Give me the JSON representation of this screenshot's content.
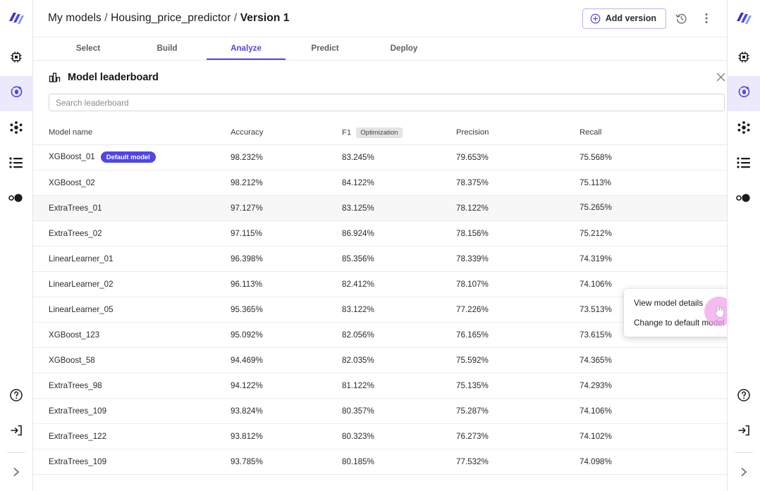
{
  "theme": {
    "accent": "#5046e5",
    "accent_soft": "#ebe9fb",
    "badge": "#5046e5",
    "cursor_halo": "#f3a0ef",
    "row_hover": "#f7f7f8",
    "page_bg": "#f4f4f4"
  },
  "breadcrumb": {
    "root": "My models",
    "project": "Housing_price_predictor",
    "current": "Version 1",
    "separator": "/"
  },
  "topbar": {
    "add_version_label": "Add version",
    "add_version_icon": "plus-circle-icon",
    "history_icon": "history-clock-icon",
    "more_icon": "kebab-vertical-icon"
  },
  "tabs": [
    {
      "label": "Select",
      "active": false
    },
    {
      "label": "Build",
      "active": false
    },
    {
      "label": "Analyze",
      "active": true
    },
    {
      "label": "Predict",
      "active": false
    },
    {
      "label": "Deploy",
      "active": false
    }
  ],
  "panel": {
    "title": "Model leaderboard",
    "title_icon": "bar-chart-icon",
    "close_icon": "close-icon"
  },
  "search": {
    "placeholder": "Search leaderboard",
    "value": ""
  },
  "table": {
    "columns": [
      {
        "key": "name",
        "label": "Model name"
      },
      {
        "key": "accuracy",
        "label": "Accuracy"
      },
      {
        "key": "f1",
        "label": "F1",
        "chip": "Optimization"
      },
      {
        "key": "precision",
        "label": "Precision"
      },
      {
        "key": "recall",
        "label": "Recall"
      }
    ],
    "default_badge": "Default model",
    "rows": [
      {
        "name": "XGBoost_01",
        "badge": "Default model",
        "accuracy": "98.232%",
        "f1": "83.245%",
        "precision": "79.653%",
        "recall": "75.568%",
        "hover": false
      },
      {
        "name": "XGBoost_02",
        "badge": "",
        "accuracy": "98.212%",
        "f1": "84.122%",
        "precision": "78.375%",
        "recall": "75.113%",
        "hover": false
      },
      {
        "name": "ExtraTrees_01",
        "badge": "",
        "accuracy": "97.127%",
        "f1": "83.125%",
        "precision": "78.122%",
        "recall": "75.265%",
        "hover": true
      },
      {
        "name": "ExtraTrees_02",
        "badge": "",
        "accuracy": "97.115%",
        "f1": "86.924%",
        "precision": "78.156%",
        "recall": "75.212%",
        "hover": false
      },
      {
        "name": "LinearLearner_01",
        "badge": "",
        "accuracy": "96.398%",
        "f1": "85.356%",
        "precision": "78.339%",
        "recall": "74.319%",
        "hover": false
      },
      {
        "name": "LinearLearner_02",
        "badge": "",
        "accuracy": "96.113%",
        "f1": "82.412%",
        "precision": "78.107%",
        "recall": "74.106%",
        "hover": false
      },
      {
        "name": "LinearLearner_05",
        "badge": "",
        "accuracy": "95.365%",
        "f1": "83.122%",
        "precision": "77.226%",
        "recall": "73.513%",
        "hover": false
      },
      {
        "name": "XGBoost_123",
        "badge": "",
        "accuracy": "95.092%",
        "f1": "82.056%",
        "precision": "76.165%",
        "recall": "73.615%",
        "hover": false
      },
      {
        "name": "XGBoost_58",
        "badge": "",
        "accuracy": "94.469%",
        "f1": "82.035%",
        "precision": "75.592%",
        "recall": "74.365%",
        "hover": false
      },
      {
        "name": "ExtraTrees_98",
        "badge": "",
        "accuracy": "94.122%",
        "f1": "81.122%",
        "precision": "75.135%",
        "recall": "74.293%",
        "hover": false
      },
      {
        "name": "ExtraTrees_109",
        "badge": "",
        "accuracy": "93.824%",
        "f1": "80.357%",
        "precision": "75.287%",
        "recall": "74.106%",
        "hover": false
      },
      {
        "name": "ExtraTrees_122",
        "badge": "",
        "accuracy": "93.812%",
        "f1": "80.323%",
        "precision": "76.273%",
        "recall": "74.102%",
        "hover": false
      },
      {
        "name": "ExtraTrees_109",
        "badge": "",
        "accuracy": "93.785%",
        "f1": "80.185%",
        "precision": "77.532%",
        "recall": "74.098%",
        "hover": false
      }
    ]
  },
  "row_menu": {
    "items": [
      {
        "label": "View model details"
      },
      {
        "label": "Change to default model"
      }
    ]
  },
  "rail": {
    "logo_icon": "app-logo-icon",
    "top_items": [
      {
        "icon": "chip-icon",
        "name": "sidebar-item-compute",
        "active": false
      },
      {
        "icon": "orbit-icon",
        "name": "sidebar-item-models",
        "active": true
      },
      {
        "icon": "nodes-icon",
        "name": "sidebar-item-pipeline",
        "active": false
      },
      {
        "icon": "list-icon",
        "name": "sidebar-item-jobs",
        "active": false
      },
      {
        "icon": "circles-icon",
        "name": "sidebar-item-data",
        "active": false
      }
    ],
    "bottom_items": [
      {
        "icon": "help-circle-icon",
        "name": "sidebar-item-help",
        "active": false
      },
      {
        "icon": "logout-icon",
        "name": "sidebar-item-signout",
        "active": false
      },
      {
        "icon": "chevron-right-icon",
        "name": "sidebar-expand",
        "active": false
      }
    ]
  }
}
